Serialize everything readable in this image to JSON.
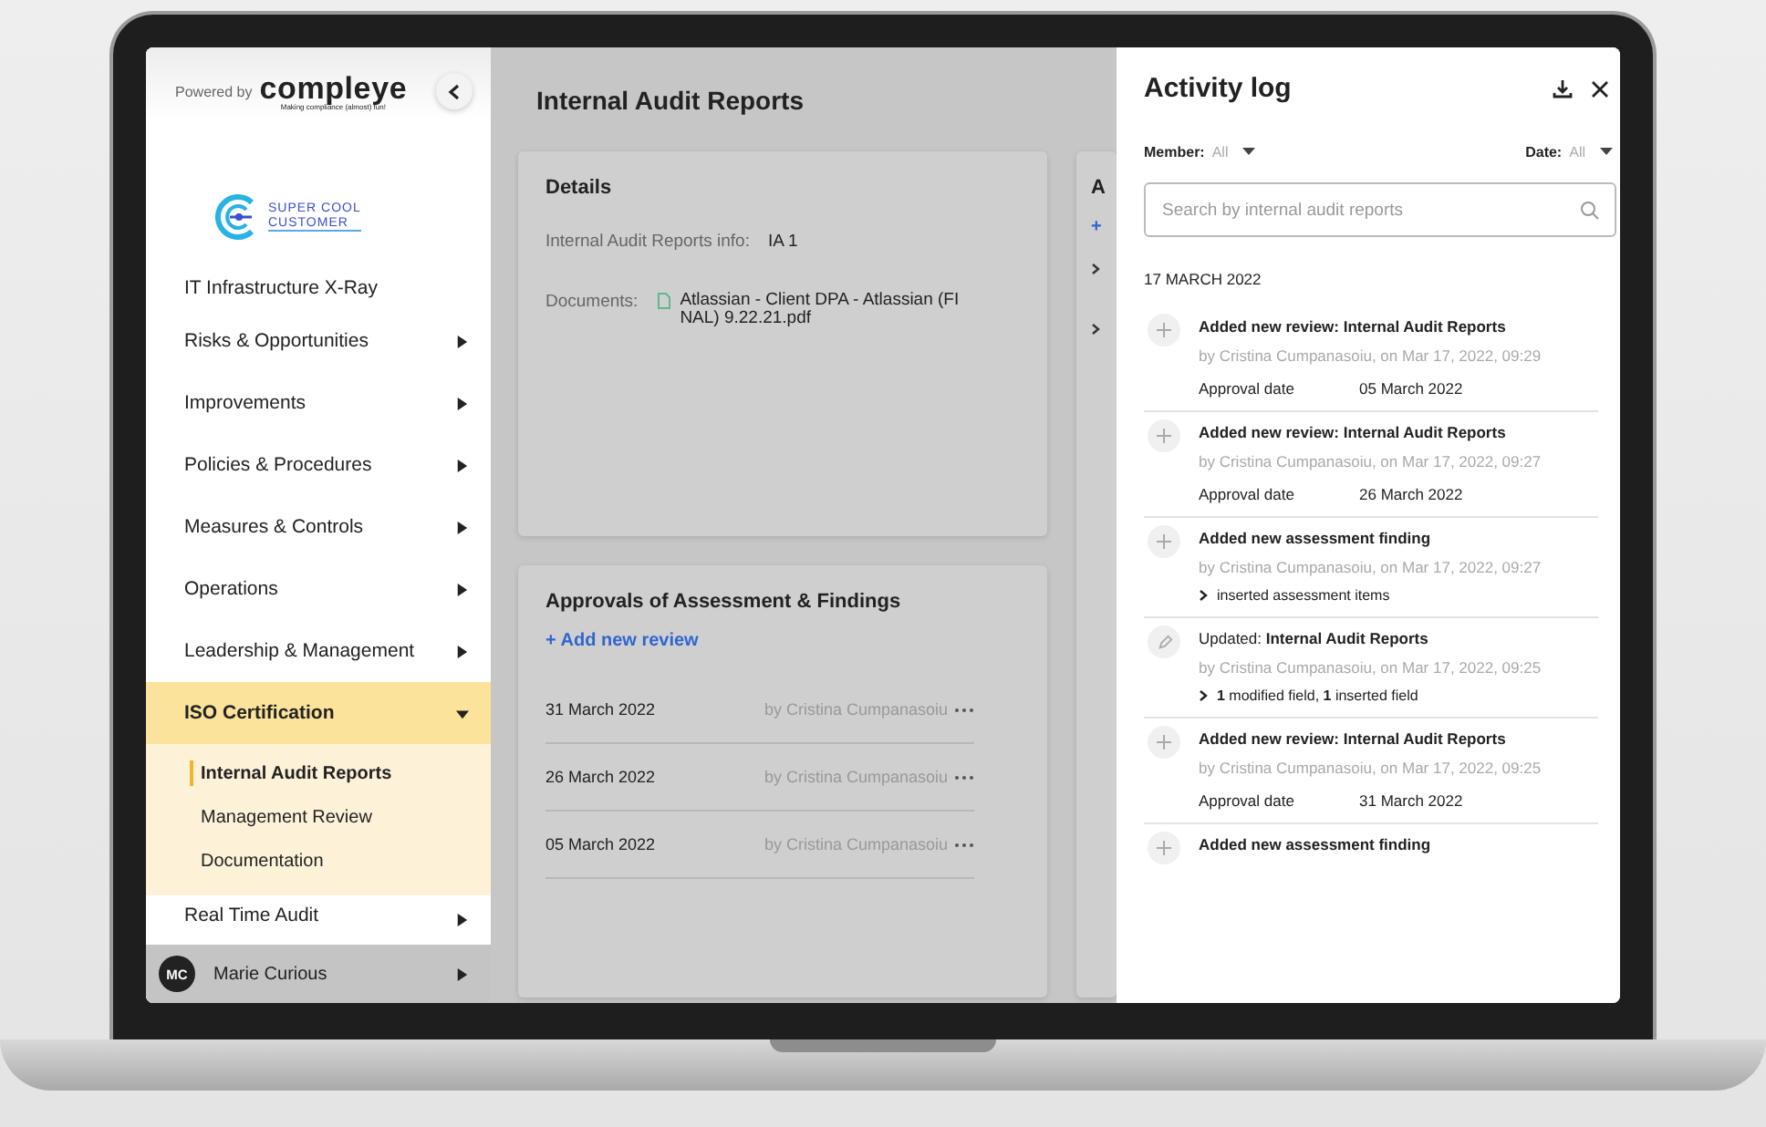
{
  "sidebar": {
    "powered_by": "Powered by",
    "brand": "compleye",
    "tagline": "Making compliance (almost) fun!",
    "customer_logo": {
      "line_1": "SUPER COOL",
      "line_2": "CUSTOMER"
    },
    "items": [
      {
        "label": "IT Infrastructure X-Ray",
        "kind": "link",
        "selected": false
      },
      {
        "label": "Risks & Opportunities",
        "kind": "group",
        "expanded": false,
        "selected": false
      },
      {
        "label": "Improvements",
        "kind": "group",
        "expanded": false,
        "selected": false
      },
      {
        "label": "Policies & Procedures",
        "kind": "group",
        "expanded": false,
        "selected": false
      },
      {
        "label": "Measures & Controls",
        "kind": "group",
        "expanded": false,
        "selected": false
      },
      {
        "label": "Operations",
        "kind": "group",
        "expanded": false,
        "selected": false
      },
      {
        "label": "Leadership & Management",
        "kind": "group",
        "expanded": false,
        "selected": false
      },
      {
        "label": "ISO Certification",
        "kind": "group",
        "expanded": true,
        "selected": true,
        "children": [
          {
            "label": "Internal Audit Reports",
            "selected": true
          },
          {
            "label": "Management Review",
            "selected": false
          },
          {
            "label": "Documentation",
            "selected": false
          }
        ]
      },
      {
        "label": "Real Time Audit",
        "kind": "group",
        "expanded": false,
        "selected": false
      }
    ],
    "user": {
      "initials": "MC",
      "name": "Marie Curious"
    }
  },
  "main": {
    "title": "Internal Audit Reports",
    "details": {
      "heading": "Details",
      "fields": [
        {
          "label": "Internal Audit Reports info:",
          "value": "IA 1",
          "kind": "text"
        },
        {
          "label": "Documents:",
          "value": "Atlassian - Client DPA - Atlassian (FI NAL) 9.22.21.pdf",
          "kind": "file"
        }
      ]
    },
    "approvals": {
      "heading": "Approvals of Assessment & Findings",
      "add_link": "+ Add new review",
      "rows": [
        {
          "date": "31 March 2022",
          "author": "by Cristina Cumpanasoiu"
        },
        {
          "date": "26 March 2022",
          "author": "by Cristina Cumpanasoiu"
        },
        {
          "date": "05 March 2022",
          "author": "by Cristina Cumpanasoiu"
        }
      ]
    },
    "side_card": {
      "heading": "A",
      "add_link": "+"
    }
  },
  "activity_log": {
    "title": "Activity log",
    "filters": [
      {
        "label": "Member:",
        "value": "All"
      },
      {
        "label": "Date:",
        "value": "All"
      }
    ],
    "search": {
      "placeholder": "Search by internal audit reports"
    },
    "date_group": "17 MARCH 2022",
    "entries": [
      {
        "kind": "review",
        "title": "Added new review: Internal Audit Reports",
        "by": "by Cristina Cumpanasoiu, on Mar 17, 2022, 09:29",
        "detail_label": "Approval date",
        "detail_value": "05 March 2022"
      },
      {
        "kind": "review",
        "title": "Added new review: Internal Audit Reports",
        "by": "by Cristina Cumpanasoiu, on Mar 17, 2022, 09:27",
        "detail_label": "Approval date",
        "detail_value": "26 March 2022"
      },
      {
        "kind": "finding",
        "title": "Added new assessment finding",
        "by": "by Cristina Cumpanasoiu, on Mar 17, 2022, 09:27",
        "summary": "inserted assessment items"
      },
      {
        "kind": "update",
        "title": "Updated: **Internal Audit Reports**",
        "by": "by Cristina Cumpanasoiu, on Mar 17, 2022, 09:25",
        "summary": "**1** modified field, **1** inserted field"
      },
      {
        "kind": "review",
        "title": "Added new review: Internal Audit Reports",
        "by": "by Cristina Cumpanasoiu, on Mar 17, 2022, 09:25",
        "detail_label": "Approval date",
        "detail_value": "31 March 2022"
      },
      {
        "kind": "finding",
        "title": "Added new assessment finding"
      }
    ]
  }
}
